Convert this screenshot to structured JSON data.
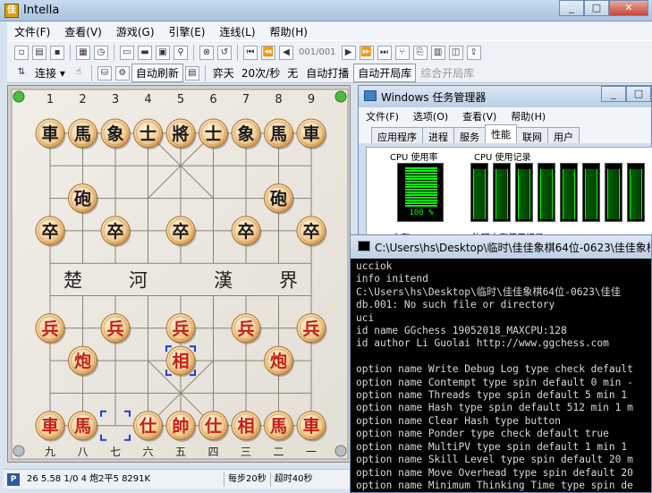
{
  "app": {
    "title": "Intella",
    "icon_text": "佳"
  },
  "menus": [
    "文件(F)",
    "查看(V)",
    "游戏(G)",
    "引擎(E)",
    "连线(L)",
    "帮助(H)"
  ],
  "toolbar": {
    "position_text": "001/001"
  },
  "toolbar2": {
    "connect_label": "连接",
    "auto_refresh": "自动刷新",
    "mode": "弈天",
    "speed": "20次/秒",
    "none": "无",
    "auto_hit": "自动打播",
    "auto_open": "自动开局库",
    "combined_open": "综合开局库"
  },
  "board": {
    "top_numbers": [
      "1",
      "2",
      "3",
      "4",
      "5",
      "6",
      "7",
      "8",
      "9"
    ],
    "bottom_numbers": [
      "九",
      "八",
      "七",
      "六",
      "五",
      "四",
      "三",
      "二",
      "一"
    ],
    "river": [
      "楚",
      "河",
      "漢",
      "界"
    ],
    "pieces": [
      {
        "c": "車",
        "col": 0,
        "row": 0,
        "side": "black"
      },
      {
        "c": "馬",
        "col": 1,
        "row": 0,
        "side": "black"
      },
      {
        "c": "象",
        "col": 2,
        "row": 0,
        "side": "black"
      },
      {
        "c": "士",
        "col": 3,
        "row": 0,
        "side": "black"
      },
      {
        "c": "將",
        "col": 4,
        "row": 0,
        "side": "black"
      },
      {
        "c": "士",
        "col": 5,
        "row": 0,
        "side": "black"
      },
      {
        "c": "象",
        "col": 6,
        "row": 0,
        "side": "black"
      },
      {
        "c": "馬",
        "col": 7,
        "row": 0,
        "side": "black"
      },
      {
        "c": "車",
        "col": 8,
        "row": 0,
        "side": "black"
      },
      {
        "c": "砲",
        "col": 1,
        "row": 2,
        "side": "black"
      },
      {
        "c": "砲",
        "col": 7,
        "row": 2,
        "side": "black"
      },
      {
        "c": "卒",
        "col": 0,
        "row": 3,
        "side": "black"
      },
      {
        "c": "卒",
        "col": 2,
        "row": 3,
        "side": "black"
      },
      {
        "c": "卒",
        "col": 4,
        "row": 3,
        "side": "black"
      },
      {
        "c": "卒",
        "col": 6,
        "row": 3,
        "side": "black"
      },
      {
        "c": "卒",
        "col": 8,
        "row": 3,
        "side": "black"
      },
      {
        "c": "兵",
        "col": 0,
        "row": 6,
        "side": "red"
      },
      {
        "c": "兵",
        "col": 2,
        "row": 6,
        "side": "red"
      },
      {
        "c": "兵",
        "col": 4,
        "row": 6,
        "side": "red"
      },
      {
        "c": "兵",
        "col": 6,
        "row": 6,
        "side": "red"
      },
      {
        "c": "兵",
        "col": 8,
        "row": 6,
        "side": "red"
      },
      {
        "c": "炮",
        "col": 1,
        "row": 7,
        "side": "red"
      },
      {
        "c": "相",
        "col": 4,
        "row": 7,
        "side": "red"
      },
      {
        "c": "炮",
        "col": 7,
        "row": 7,
        "side": "red"
      },
      {
        "c": "車",
        "col": 0,
        "row": 9,
        "side": "red"
      },
      {
        "c": "馬",
        "col": 1,
        "row": 9,
        "side": "red"
      },
      {
        "c": "仕",
        "col": 3,
        "row": 9,
        "side": "red"
      },
      {
        "c": "帥",
        "col": 4,
        "row": 9,
        "side": "red"
      },
      {
        "c": "仕",
        "col": 5,
        "row": 9,
        "side": "red"
      },
      {
        "c": "相",
        "col": 6,
        "row": 9,
        "side": "red"
      },
      {
        "c": "馬",
        "col": 7,
        "row": 9,
        "side": "red"
      },
      {
        "c": "車",
        "col": 8,
        "row": 9,
        "side": "red"
      }
    ],
    "last_move_marks": [
      {
        "col": 2,
        "row": 9
      },
      {
        "col": 4,
        "row": 7
      }
    ]
  },
  "statusbar": {
    "icon": "P",
    "info": "26 5.58 1/0 4 炮2平5  8291K",
    "time_per_move": "每步20秒",
    "timeout": "超时40秒"
  },
  "taskmgr": {
    "title": "Windows 任务管理器",
    "menus": [
      "文件(F)",
      "选项(O)",
      "查看(V)",
      "帮助(H)"
    ],
    "tabs": [
      "应用程序",
      "进程",
      "服务",
      "性能",
      "联网",
      "用户"
    ],
    "active_tab": "性能",
    "cpu_usage_label": "CPU 使用率",
    "cpu_history_label": "CPU 使用记录",
    "cpu_percent": "100 %",
    "memory_label": "内存",
    "physical_memory_label": "物理内存使用记录"
  },
  "console": {
    "title": "C:\\Users\\hs\\Desktop\\临时\\佳佳象棋64位-0623\\佳佳象棋64位",
    "lines": [
      "ucciok",
      "info initend",
      "C:\\Users\\hs\\Desktop\\临时\\佳佳象棋64位-0623\\佳佳",
      "db.001: No such file or directory",
      "uci",
      "id name GGchess 19052018_MAXCPU:128",
      "id author Li Guolai http://www.ggchess.com",
      "",
      "option name Write Debug Log type check default",
      "option name Contempt type spin default 0 min -",
      "option name Threads type spin default 5 min 1",
      "option name Hash type spin default 512 min 1 m",
      "option name Clear Hash type button",
      "option name Ponder type check default true",
      "option name MultiPV type spin default 1 min 1",
      "option name Skill Level type spin default 20 m",
      "option name Move Overhead type spin default 20",
      "option name Minimum Thinking Time type spin de"
    ]
  }
}
